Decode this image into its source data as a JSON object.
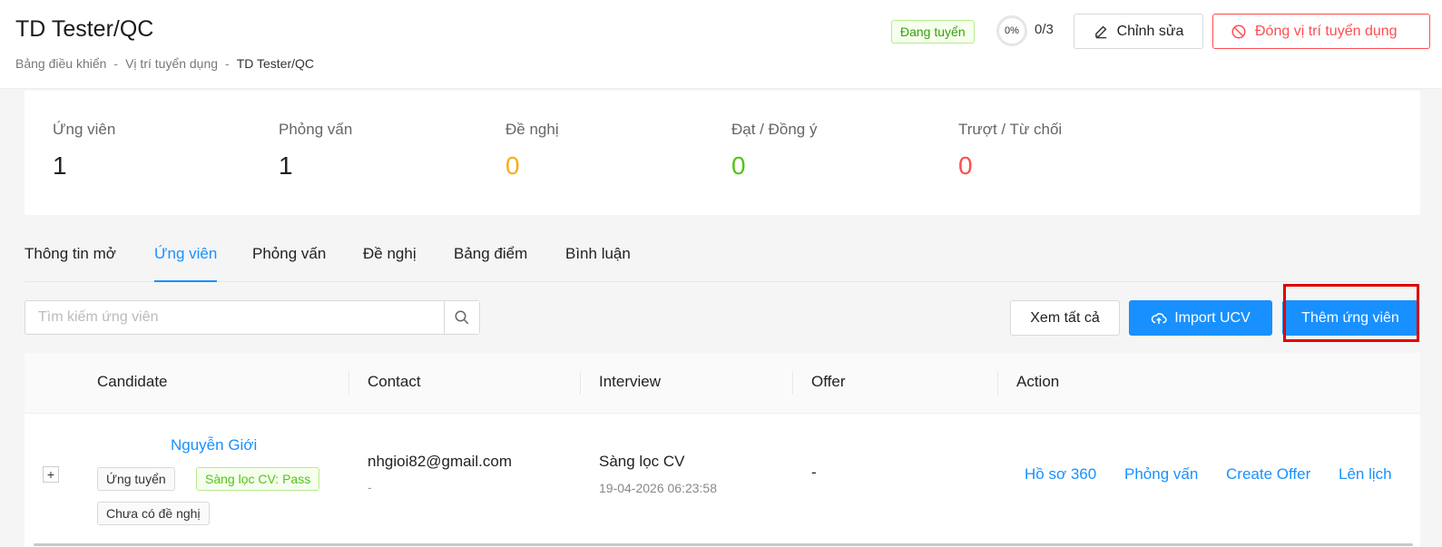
{
  "header": {
    "title": "TD Tester/QC",
    "breadcrumb": [
      "Bảng điều khiển",
      "Vị trí tuyển dụng",
      "TD Tester/QC"
    ],
    "breadcrumb_sep": "-",
    "status": "Đang tuyển",
    "progress_percent": "0%",
    "progress_count": "0/3",
    "edit_label": "Chỉnh sửa",
    "close_label": "Đóng vị trí tuyển dụng",
    "edit_icon": "pencil-icon",
    "close_icon": "ban-icon"
  },
  "stats": [
    {
      "label": "Ứng viên",
      "value": "1",
      "color": "#222222"
    },
    {
      "label": "Phỏng vấn",
      "value": "1",
      "color": "#222222"
    },
    {
      "label": "Đề nghị",
      "value": "0",
      "color": "#faad14"
    },
    {
      "label": "Đạt / Đồng ý",
      "value": "0",
      "color": "#52c41a"
    },
    {
      "label": "Trượt / Từ chối",
      "value": "0",
      "color": "#ff4d4f"
    }
  ],
  "tabs": [
    {
      "label": "Thông tin mở",
      "active": false
    },
    {
      "label": "Ứng viên",
      "active": true
    },
    {
      "label": "Phỏng vấn",
      "active": false
    },
    {
      "label": "Đề nghị",
      "active": false
    },
    {
      "label": "Bảng điểm",
      "active": false
    },
    {
      "label": "Bình luận",
      "active": false
    }
  ],
  "toolbar": {
    "search_placeholder": "Tìm kiếm ứng viên",
    "view_all_label": "Xem tất cả",
    "import_label": "Import UCV",
    "add_label": "Thêm ứng viên",
    "import_icon": "cloud-upload-icon",
    "search_icon": "search-icon"
  },
  "table": {
    "columns": [
      "Candidate",
      "Contact",
      "Interview",
      "Offer",
      "Action"
    ],
    "rows": [
      {
        "expand": "+",
        "name": "Nguyễn Giới",
        "tags": [
          "Ứng tuyển",
          "Sàng lọc CV: Pass",
          "Chưa có đề nghị"
        ],
        "email": "nhgioi82@gmail.com",
        "phone": "-",
        "interview_stage": "Sàng lọc CV",
        "interview_time": "19-04-2026 06:23:58",
        "offer": "-",
        "actions": [
          "Hồ sơ 360",
          "Phỏng vấn",
          "Create Offer",
          "Lên lịch"
        ]
      }
    ]
  },
  "colors": {
    "primary": "#1890ff",
    "danger": "#ff4d4f",
    "success": "#52c41a",
    "warning": "#faad14",
    "highlight": "#e00000"
  }
}
